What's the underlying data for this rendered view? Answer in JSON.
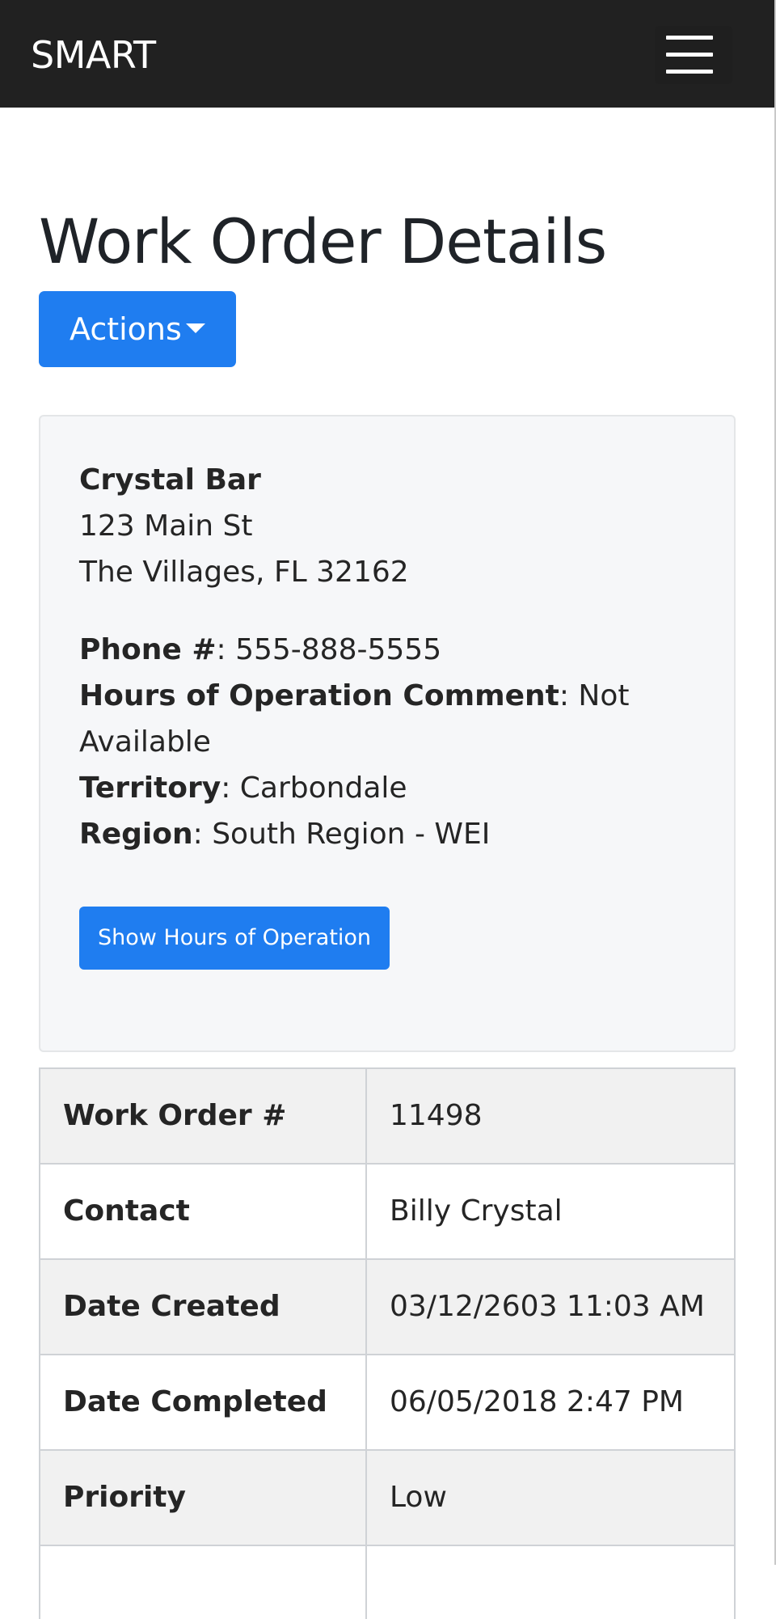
{
  "header": {
    "brand": "SMART",
    "menu_icon": "hamburger-icon"
  },
  "page": {
    "title": "Work Order Details",
    "actions_label": "Actions",
    "actions_icon": "caret-down-icon"
  },
  "location": {
    "name": "Crystal Bar",
    "address_line1": "123 Main St",
    "address_line2": "The Villages, FL 32162",
    "phone_label": "Phone #",
    "phone_value": "555-888-5555",
    "hours_comment_label": "Hours of Operation Comment",
    "hours_comment_value_line1": "Not",
    "hours_comment_value_line2": "Available",
    "territory_label": "Territory",
    "territory_value": "Carbondale",
    "region_label": "Region",
    "region_value": "South Region - WEI",
    "show_hours_button": "Show Hours of Operation"
  },
  "details_table": {
    "rows": [
      {
        "label": "Work Order #",
        "value": "11498"
      },
      {
        "label": "Contact",
        "value": "Billy Crystal"
      },
      {
        "label": "Date Created",
        "value": "03/12/2603 11:03 AM"
      },
      {
        "label": "Date Completed",
        "value": "06/05/2018 2:47 PM"
      },
      {
        "label": "Priority",
        "value": "Low"
      }
    ]
  }
}
